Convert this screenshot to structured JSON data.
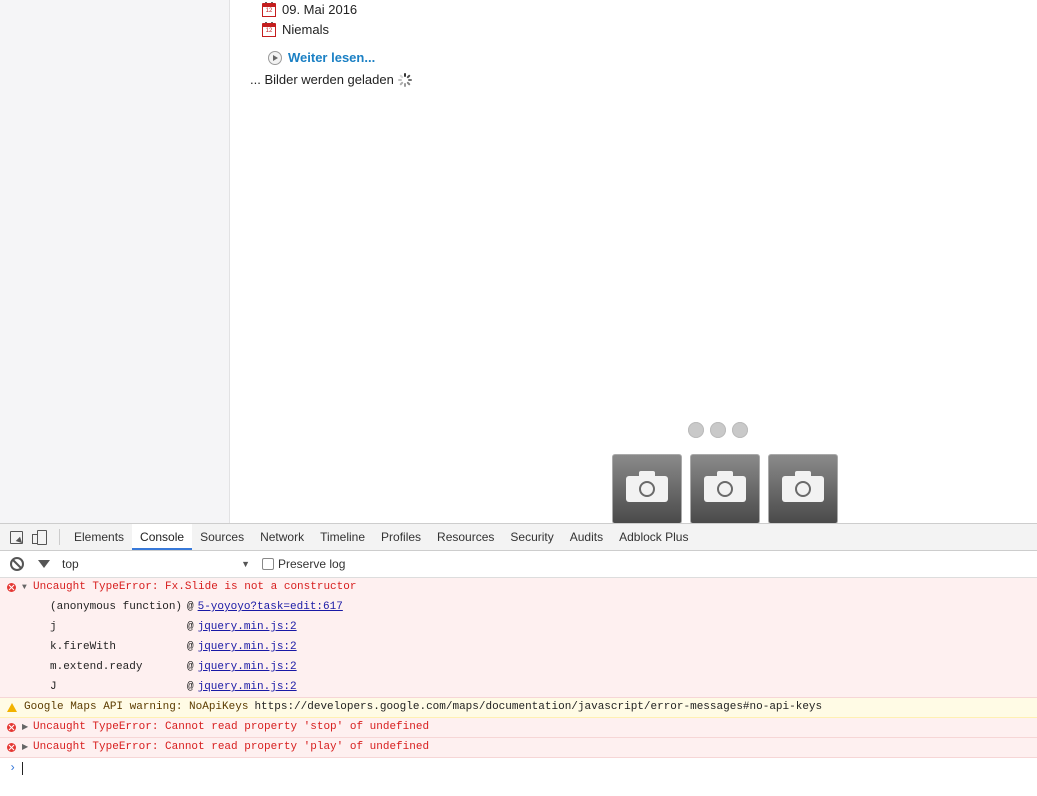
{
  "page": {
    "dates": [
      {
        "icon_text": "12",
        "label": "09. Mai 2016"
      },
      {
        "icon_text": "12",
        "label": "Niemals"
      }
    ],
    "read_more": "Weiter lesen...",
    "loading_text": "... Bilder werden geladen",
    "slider_dots": 3,
    "thumbnails": 3
  },
  "devtools": {
    "tabs": [
      "Elements",
      "Console",
      "Sources",
      "Network",
      "Timeline",
      "Profiles",
      "Resources",
      "Security",
      "Audits",
      "Adblock Plus"
    ],
    "active_tab": "Console",
    "context": "top",
    "preserve_log_label": "Preserve log",
    "messages": [
      {
        "type": "error",
        "expanded": true,
        "text": "Uncaught TypeError: Fx.Slide is not a constructor",
        "stack": [
          {
            "fn": "(anonymous function)",
            "link": "5-yoyoyo?task=edit:617"
          },
          {
            "fn": "j",
            "link": "jquery.min.js:2"
          },
          {
            "fn": "k.fireWith",
            "link": "jquery.min.js:2"
          },
          {
            "fn": "m.extend.ready",
            "link": "jquery.min.js:2"
          },
          {
            "fn": "J",
            "link": "jquery.min.js:2"
          }
        ]
      },
      {
        "type": "warn",
        "text": "Google Maps API warning: NoApiKeys",
        "url": "https://developers.google.com/maps/documentation/javascript/error-messages#no-api-keys"
      },
      {
        "type": "error",
        "expanded": false,
        "text": "Uncaught TypeError: Cannot read property 'stop' of undefined"
      },
      {
        "type": "error",
        "expanded": false,
        "text": "Uncaught TypeError: Cannot read property 'play' of undefined"
      }
    ],
    "prompt_symbol": "›"
  },
  "colors": {
    "link_blue": "#1b80c4",
    "error_red": "#d71e1e",
    "active_tab_underline": "#3879d9"
  }
}
